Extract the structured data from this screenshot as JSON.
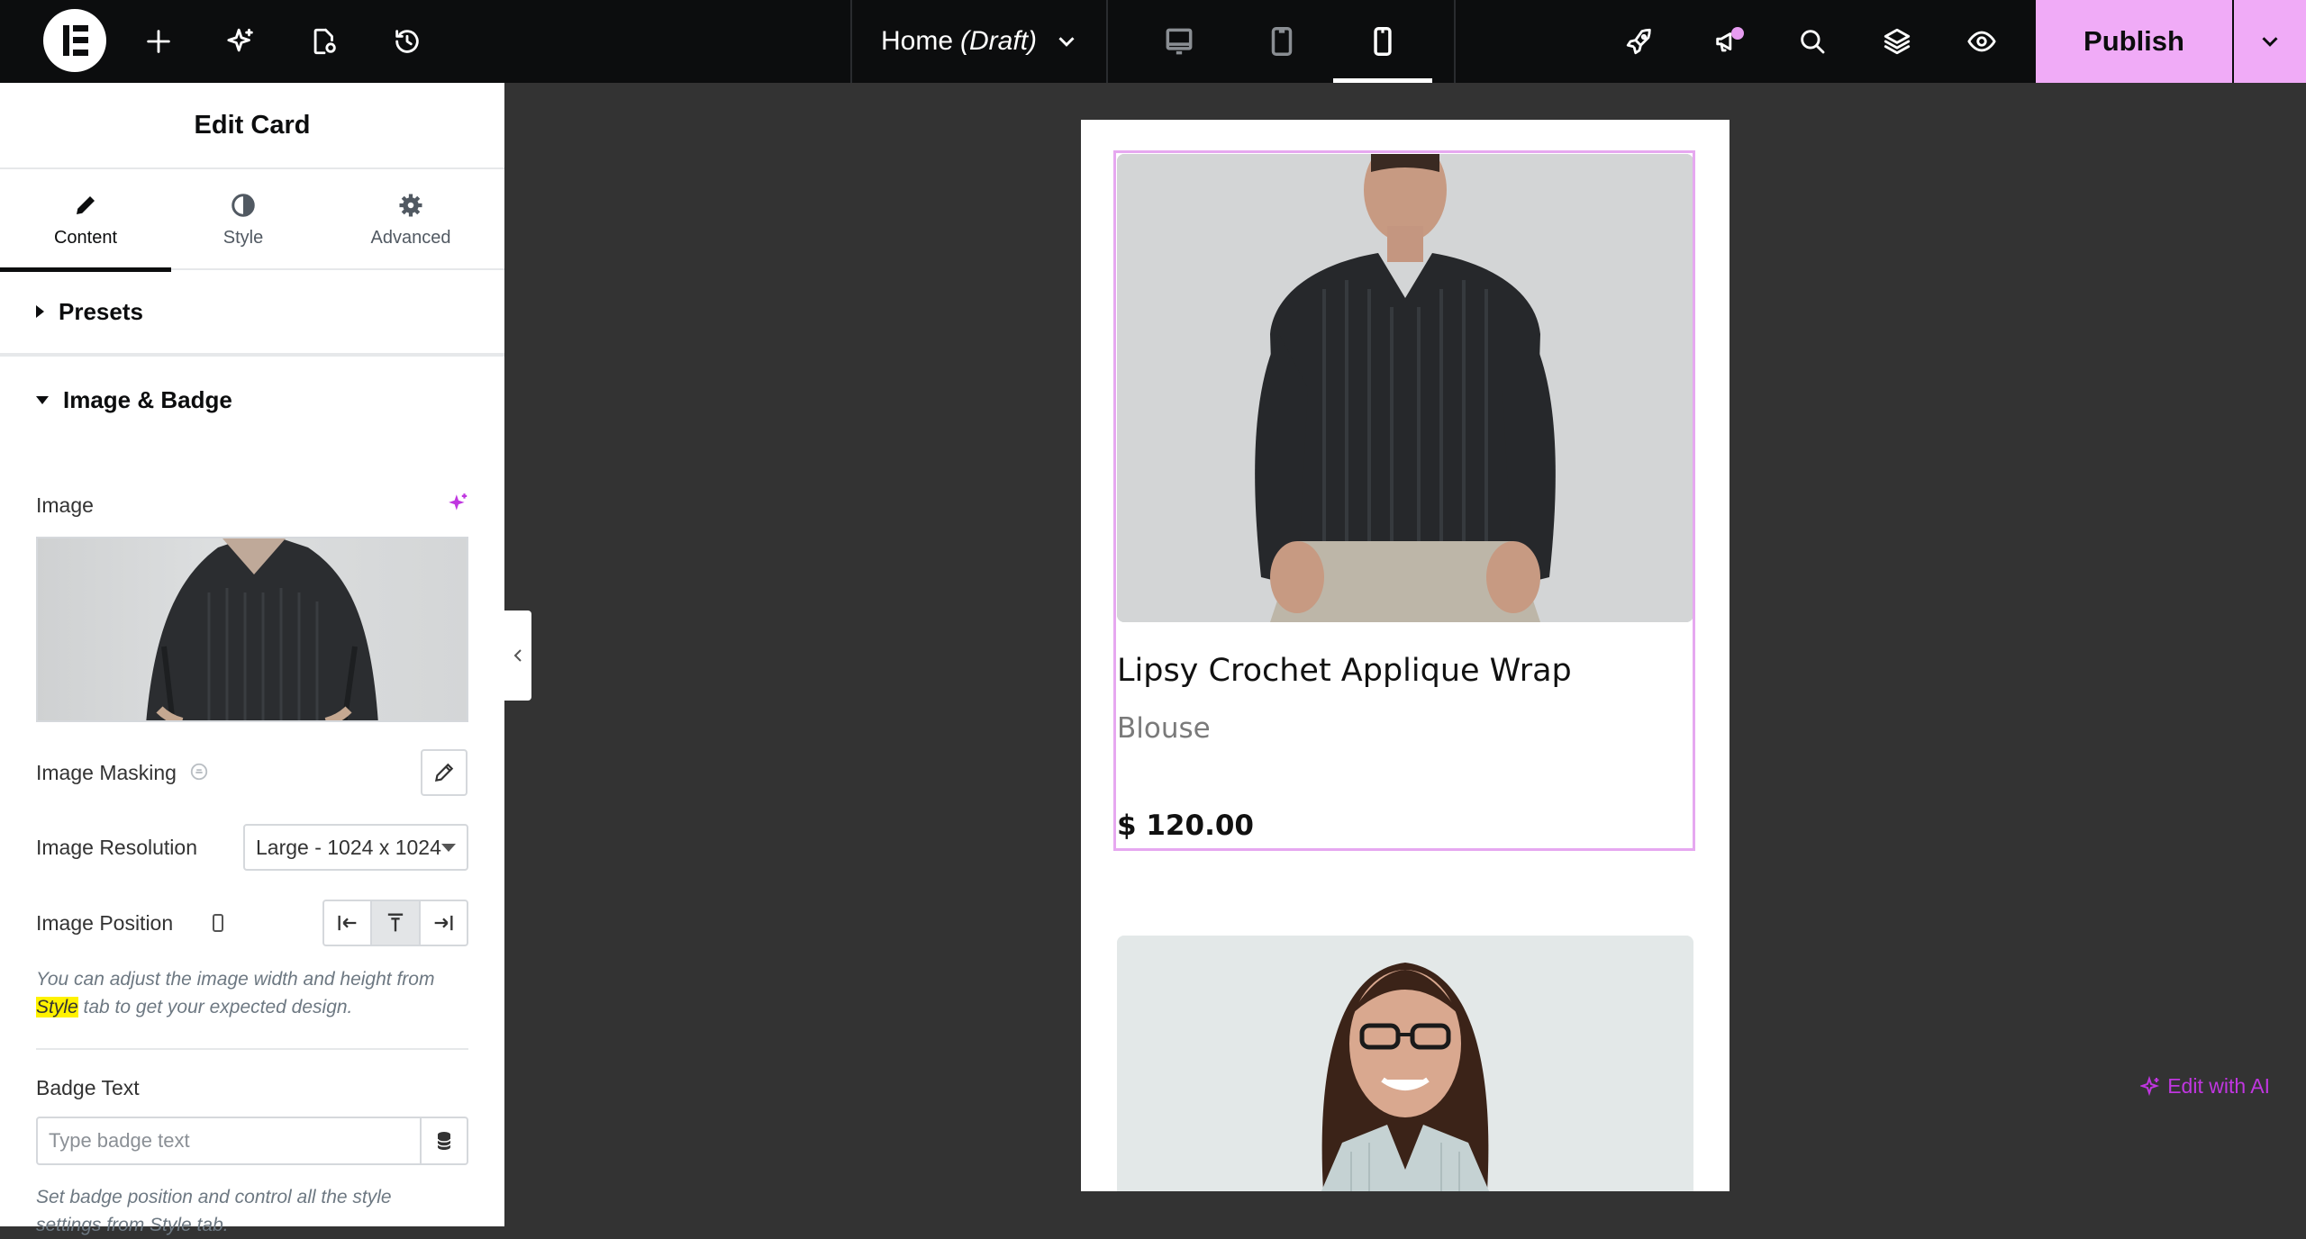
{
  "topbar": {
    "document_title": "Home",
    "document_status": "(Draft)",
    "publish_label": "Publish"
  },
  "panel": {
    "title": "Edit Card",
    "tabs": [
      {
        "label": "Content"
      },
      {
        "label": "Style"
      },
      {
        "label": "Advanced"
      }
    ],
    "sections": {
      "presets": "Presets",
      "image_badge": "Image & Badge"
    },
    "controls": {
      "image_label": "Image",
      "image_masking_label": "Image Masking",
      "image_resolution_label": "Image Resolution",
      "image_resolution_value": "Large - 1024 x 1024",
      "image_position_label": "Image Position",
      "help_image_before": "You can adjust the image width and height from ",
      "help_image_highlight": "Style",
      "help_image_after": " tab to get your expected design.",
      "badge_text_label": "Badge Text",
      "edit_with_ai": "Edit with AI",
      "badge_placeholder": "Type badge text",
      "help_badge": "Set badge position and control all the style settings from Style tab."
    }
  },
  "canvas": {
    "cards": [
      {
        "title": "Lipsy Crochet Applique Wrap",
        "subtitle": "Blouse",
        "price": "$ 120.00"
      }
    ]
  },
  "colors": {
    "accent_pink": "#f0abf7",
    "ai_purple": "#c036e0",
    "topbar_bg": "#0c0d0e",
    "canvas_bg": "#333333"
  }
}
